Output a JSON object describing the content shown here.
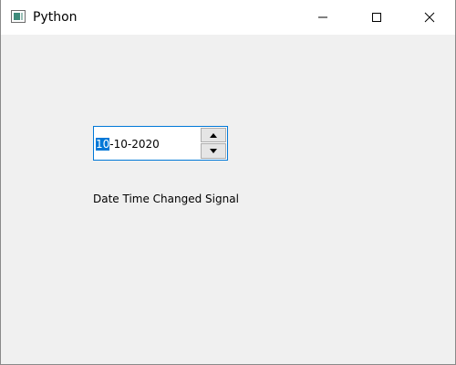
{
  "window": {
    "title": "Python",
    "icon": "python-window-icon",
    "controls": [
      "minimize-icon",
      "maximize-icon",
      "close-icon"
    ]
  },
  "date_edit": {
    "selected_segment": "10",
    "rest": "-10-2020",
    "spin_up": "up-arrow-icon",
    "spin_down": "down-arrow-icon",
    "accent": "#0078d7"
  },
  "label": {
    "text": "Date Time Changed Signal"
  }
}
